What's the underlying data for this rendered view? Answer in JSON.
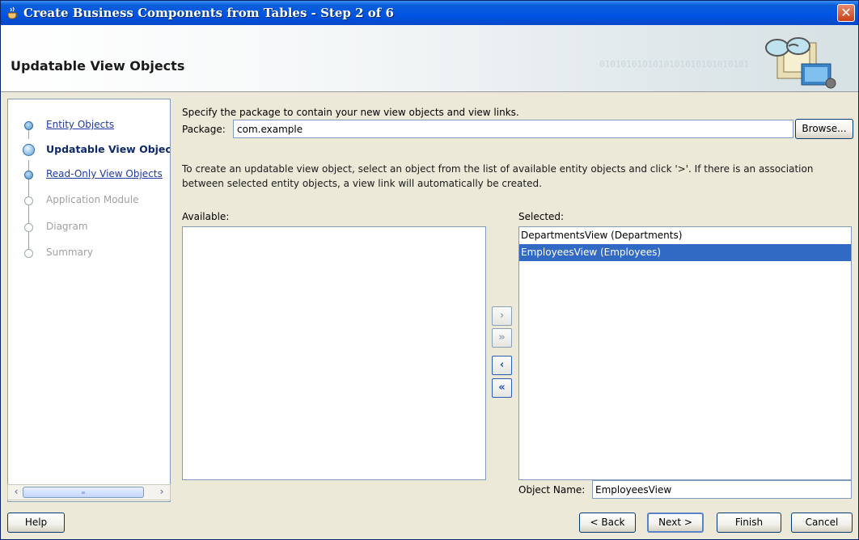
{
  "window": {
    "title": "Create Business Components from Tables - Step 2 of 6",
    "close_symbol": "✕"
  },
  "banner": {
    "heading": "Updatable View Objects",
    "binary_text": "0101010101010101010101010101"
  },
  "nav": {
    "items": [
      {
        "label": "Entity Objects",
        "state": "link"
      },
      {
        "label": "Updatable View Objects",
        "state": "current"
      },
      {
        "label": "Read-Only View Objects",
        "state": "link"
      },
      {
        "label": "Application Module",
        "state": "disabled"
      },
      {
        "label": "Diagram",
        "state": "disabled"
      },
      {
        "label": "Summary",
        "state": "disabled"
      }
    ]
  },
  "content": {
    "intro": "Specify the package to contain your new view objects and view links.",
    "package_label": "Package:",
    "package_value": "com.example",
    "browse_label": "Browse...",
    "info": "To create an updatable view object, select an object from the list of available entity objects and click '>'.  If there is an association between selected entity objects, a view link will automatically be created.",
    "available_label": "Available:",
    "selected_label": "Selected:",
    "selected_items": [
      {
        "label": "DepartmentsView (Departments)",
        "selected": false
      },
      {
        "label": "EmployeesView (Employees)",
        "selected": true
      }
    ],
    "shuttle": {
      "add": "›",
      "add_all": "»",
      "remove": "‹",
      "remove_all": "«"
    },
    "object_name_label": "Object Name:",
    "object_name_value": "EmployeesView"
  },
  "footer": {
    "help": "Help",
    "back": "< Back",
    "next": "Next >",
    "finish": "Finish",
    "cancel": "Cancel"
  },
  "colors": {
    "titlebar": "#0054e3",
    "selection": "#316ac5",
    "link": "#1f3ba3"
  }
}
